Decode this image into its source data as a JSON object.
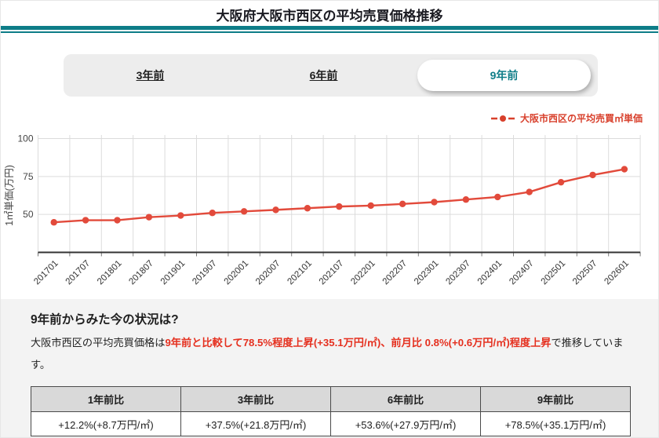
{
  "page": {
    "title": "大阪府大阪市西区の平均売買価格推移"
  },
  "colors": {
    "accent_teal": "#0e7d88",
    "series_red": "#e24a3b",
    "legend_text_red": "#d8402c",
    "highlight_red": "#e5301f",
    "table_header_bg": "#d9d9d9",
    "panel_bg": "#f3f3f3"
  },
  "tabs": [
    {
      "label": "3年前",
      "active": false
    },
    {
      "label": "6年前",
      "active": false
    },
    {
      "label": "9年前",
      "active": true
    }
  ],
  "legend": {
    "label": "大阪市西区の平均売買㎡単価"
  },
  "chart_data": {
    "type": "line",
    "title": "",
    "x": [
      "201701",
      "201707",
      "201801",
      "201807",
      "201901",
      "201907",
      "202001",
      "202007",
      "202101",
      "202107",
      "202201",
      "202207",
      "202301",
      "202307",
      "202401",
      "202407",
      "202501",
      "202507",
      "202601"
    ],
    "series": [
      {
        "name": "大阪市西区の平均売買㎡単価",
        "values": [
          44.8,
          46.2,
          46.2,
          48.2,
          49.3,
          51.0,
          52.0,
          53.0,
          54.1,
          55.2,
          55.8,
          56.9,
          58.1,
          59.8,
          61.5,
          64.8,
          71.2,
          76.0,
          79.8
        ]
      }
    ],
    "xlabel": "",
    "ylabel": "1㎡単価(万円)",
    "ylim": [
      25,
      100
    ],
    "yticks": [
      50,
      75,
      100
    ],
    "grid": true,
    "legend_position": "top-right",
    "line_color": "#e24a3b"
  },
  "summary": {
    "heading": "9年前からみた今の状況は?",
    "intro": "大阪市西区の平均売買価格は",
    "highlight": "9年前と比較して78.5%程度上昇(+35.1万円/㎡)、前月比 0.8%(+0.6万円/㎡)程度上昇",
    "outro": "で推移しています。"
  },
  "comparison_table": {
    "headers": [
      "1年前比",
      "3年前比",
      "6年前比",
      "9年前比"
    ],
    "values": [
      "+12.2%(+8.7万円/㎡)",
      "+37.5%(+21.8万円/㎡)",
      "+53.6%(+27.9万円/㎡)",
      "+78.5%(+35.1万円/㎡)"
    ]
  }
}
